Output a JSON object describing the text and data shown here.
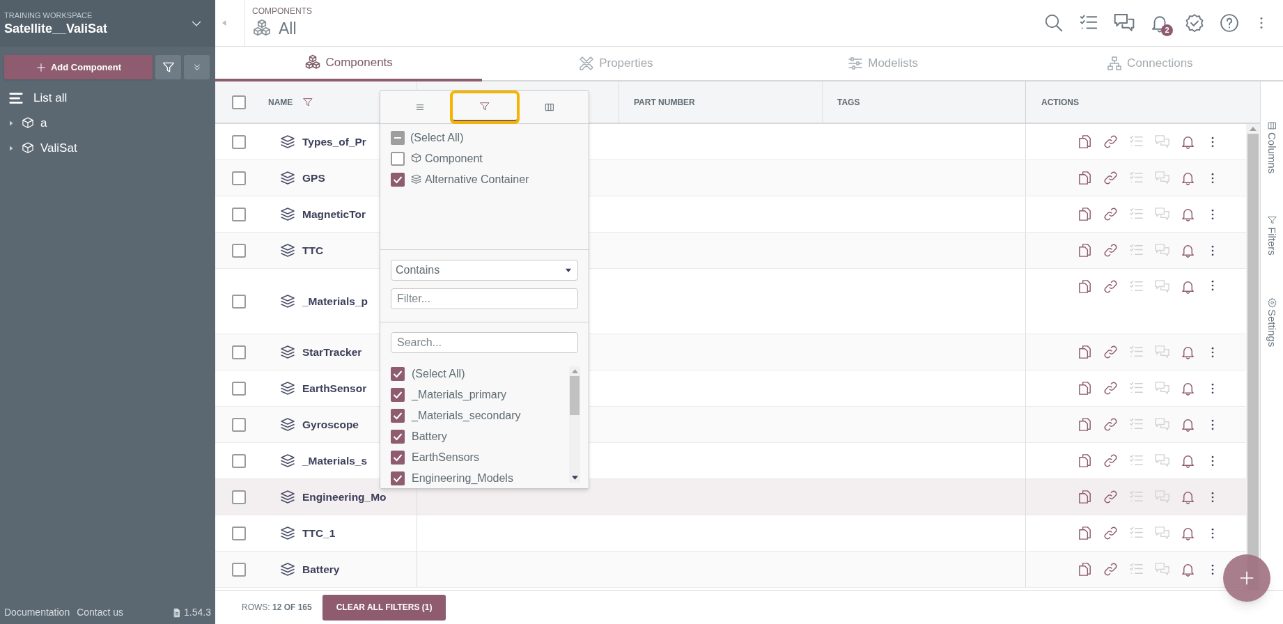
{
  "sidebar": {
    "workspace_label": "TRAINING WORKSPACE",
    "workspace_name": "Satellite__ValiSat",
    "add_button": "Add Component",
    "tree": [
      {
        "label": "List all",
        "kind": "list"
      },
      {
        "label": "a",
        "kind": "component",
        "expanded": false
      },
      {
        "label": "ValiSat",
        "kind": "component",
        "expanded": false
      }
    ],
    "footer_links": [
      "Documentation",
      "Contact us"
    ],
    "version": "1.54.3"
  },
  "header": {
    "section": "COMPONENTS",
    "title": "All",
    "notification_count": "2"
  },
  "tabs": [
    {
      "label": "Components",
      "kind": "components",
      "selected": true
    },
    {
      "label": "Properties",
      "kind": "properties",
      "selected": false
    },
    {
      "label": "Modelists",
      "kind": "modelists",
      "selected": false
    },
    {
      "label": "Connections",
      "kind": "connections",
      "selected": false
    }
  ],
  "table": {
    "all_checked": false,
    "columns": [
      "NAME",
      "PART NUMBER",
      "TAGS",
      "ACTIONS"
    ],
    "rows": [
      {
        "name": "Types_of_Pr",
        "checked": false,
        "tall": false,
        "hovered": false
      },
      {
        "name": "GPS",
        "checked": false,
        "tall": false,
        "hovered": false
      },
      {
        "name": "MagneticTor",
        "checked": false,
        "tall": false,
        "hovered": false
      },
      {
        "name": "TTC",
        "checked": false,
        "tall": false,
        "hovered": false
      },
      {
        "name": "_Materials_p",
        "checked": false,
        "tall": true,
        "hovered": false
      },
      {
        "name": "StarTracker",
        "checked": false,
        "tall": false,
        "hovered": false
      },
      {
        "name": "EarthSensor",
        "checked": false,
        "tall": false,
        "hovered": false
      },
      {
        "name": "Gyroscope",
        "checked": false,
        "tall": false,
        "hovered": false
      },
      {
        "name": "_Materials_s",
        "checked": false,
        "tall": false,
        "hovered": false
      },
      {
        "name": "Engineering_Mo",
        "checked": false,
        "tall": false,
        "hovered": true
      },
      {
        "name": "TTC_1",
        "checked": false,
        "tall": false,
        "hovered": false
      },
      {
        "name": "Battery",
        "checked": false,
        "tall": false,
        "hovered": false
      }
    ]
  },
  "filter_popup": {
    "tabs": [
      {
        "kind": "menu",
        "selected": false
      },
      {
        "kind": "filter",
        "selected": true
      },
      {
        "kind": "columns",
        "selected": false
      }
    ],
    "type_options": [
      {
        "label": "(Select All)",
        "checked": false,
        "indeterminate": true,
        "kind": "all"
      },
      {
        "label": "Component",
        "checked": false,
        "indeterminate": false,
        "kind": "component"
      },
      {
        "label": "Alternative Container",
        "checked": true,
        "indeterminate": false,
        "kind": "container"
      }
    ],
    "operator": "Contains",
    "filter_placeholder": "Filter...",
    "search_placeholder": "Search...",
    "values": [
      {
        "label": "(Select All)",
        "checked": true
      },
      {
        "label": "_Materials_primary",
        "checked": true
      },
      {
        "label": "_Materials_secondary",
        "checked": true
      },
      {
        "label": "Battery",
        "checked": true
      },
      {
        "label": "EarthSensors",
        "checked": true
      },
      {
        "label": "Engineering_Models",
        "checked": true
      }
    ]
  },
  "side_panel": [
    {
      "label": "Columns",
      "kind": "columns"
    },
    {
      "label": "Filters",
      "kind": "filters"
    },
    {
      "label": "Settings",
      "kind": "settings"
    }
  ],
  "footer": {
    "rows": "ROWS: **12 OF 165**",
    "clear_button": "CLEAR ALL FILTERS (1)"
  }
}
